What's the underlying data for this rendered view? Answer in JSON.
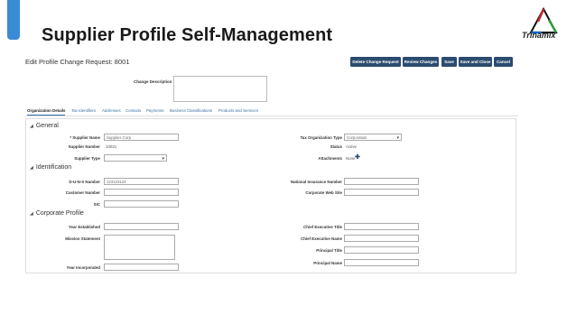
{
  "slide": {
    "title": "Supplier Profile Self-Management",
    "logo_text": "Trinamix",
    "accent_color": "#3a8bd6"
  },
  "header": {
    "title": "Edit Profile Change Request: 8001",
    "buttons": {
      "delete": "Delete Change Request",
      "review": "Review Changes",
      "save": "Save",
      "save_close": "Save and Close",
      "cancel": "Cancel"
    }
  },
  "change_description": {
    "label": "Change Description",
    "value": ""
  },
  "tabs": [
    "Organization Details",
    "Tax Identifiers",
    "Addresses",
    "Contacts",
    "Payments",
    "Business Classifications",
    "Products and Services"
  ],
  "general": {
    "title": "General",
    "supplier_name": {
      "label": "* Supplier Name",
      "value": "Supplies Corp"
    },
    "supplier_number": {
      "label": "Supplier Number",
      "value": "10021"
    },
    "supplier_type": {
      "label": "Supplier Type",
      "value": ""
    },
    "tax_org_type": {
      "label": "Tax Organization Type",
      "value": "Corporation"
    },
    "status": {
      "label": "Status",
      "value": "Active"
    },
    "attachments": {
      "label": "Attachments",
      "value": "None"
    }
  },
  "identification": {
    "title": "Identification",
    "duns": {
      "label": "D-U-N-S Number",
      "value": "123123123"
    },
    "customer_number": {
      "label": "Customer Number",
      "value": ""
    },
    "sic": {
      "label": "SIC",
      "value": ""
    },
    "national_insurance": {
      "label": "National Insurance Number",
      "value": ""
    },
    "corporate_web": {
      "label": "Corporate Web Site",
      "value": ""
    }
  },
  "corporate": {
    "title": "Corporate Profile",
    "year_established": {
      "label": "Year Established",
      "value": ""
    },
    "mission": {
      "label": "Mission Statement",
      "value": ""
    },
    "year_incorporated": {
      "label": "Year Incorporated",
      "value": ""
    },
    "ceo_title": {
      "label": "Chief Executive Title",
      "value": ""
    },
    "ceo_name": {
      "label": "Chief Executive Name",
      "value": ""
    },
    "principal_title": {
      "label": "Principal Title",
      "value": ""
    },
    "principal_name": {
      "label": "Principal Name",
      "value": ""
    }
  }
}
